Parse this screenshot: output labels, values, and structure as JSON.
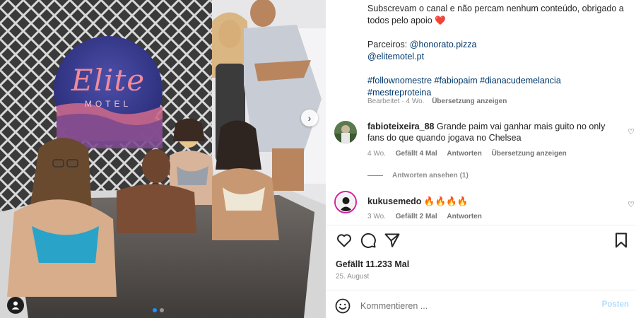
{
  "post": {
    "caption_line1": "Subscrevam o canal e não percam nenhum conteúdo, obrigado a todos pelo apoio",
    "caption_heart": "❤️",
    "partners_label": "Parceiros:",
    "partner_1": "@honorato.pizza",
    "partner_2": "@elitemotel.pt",
    "hashtags_line1": "#follownomestre #fabiopaim #dianacudemelancia",
    "hashtags_line2": "#mestreproteina",
    "edited": "Bearbeitet",
    "age": "4 Wo.",
    "see_translation": "Übersetzung anzeigen"
  },
  "photo": {
    "sign_line1": "Elite",
    "sign_line2": "MOTEL"
  },
  "comments": [
    {
      "username": "fabioteixeira_88",
      "text": "Grande paim vai ganhar mais guito no only fans do que quando jogava no Chelsea",
      "age": "4 Wo.",
      "likes": "Gefällt 4 Mal",
      "reply": "Antworten",
      "translate": "Übersetzung anzeigen",
      "view_replies": "Antworten ansehen (1)"
    },
    {
      "username": "kukusemedo",
      "text": "🔥🔥🔥🔥",
      "age": "3 Wo.",
      "likes": "Gefällt 2 Mal",
      "reply": "Antworten"
    }
  ],
  "stats": {
    "likes": "Gefällt 11.233 Mal",
    "date": "25. August"
  },
  "composer": {
    "placeholder": "Kommentieren ...",
    "post_label": "Posten"
  },
  "icons": {
    "like": "heart-outline-icon",
    "comment": "speech-bubble-icon",
    "share": "paper-plane-icon",
    "save": "bookmark-icon",
    "emoji": "smiley-icon",
    "tags": "user-tag-icon",
    "next": "chevron-right-icon"
  }
}
